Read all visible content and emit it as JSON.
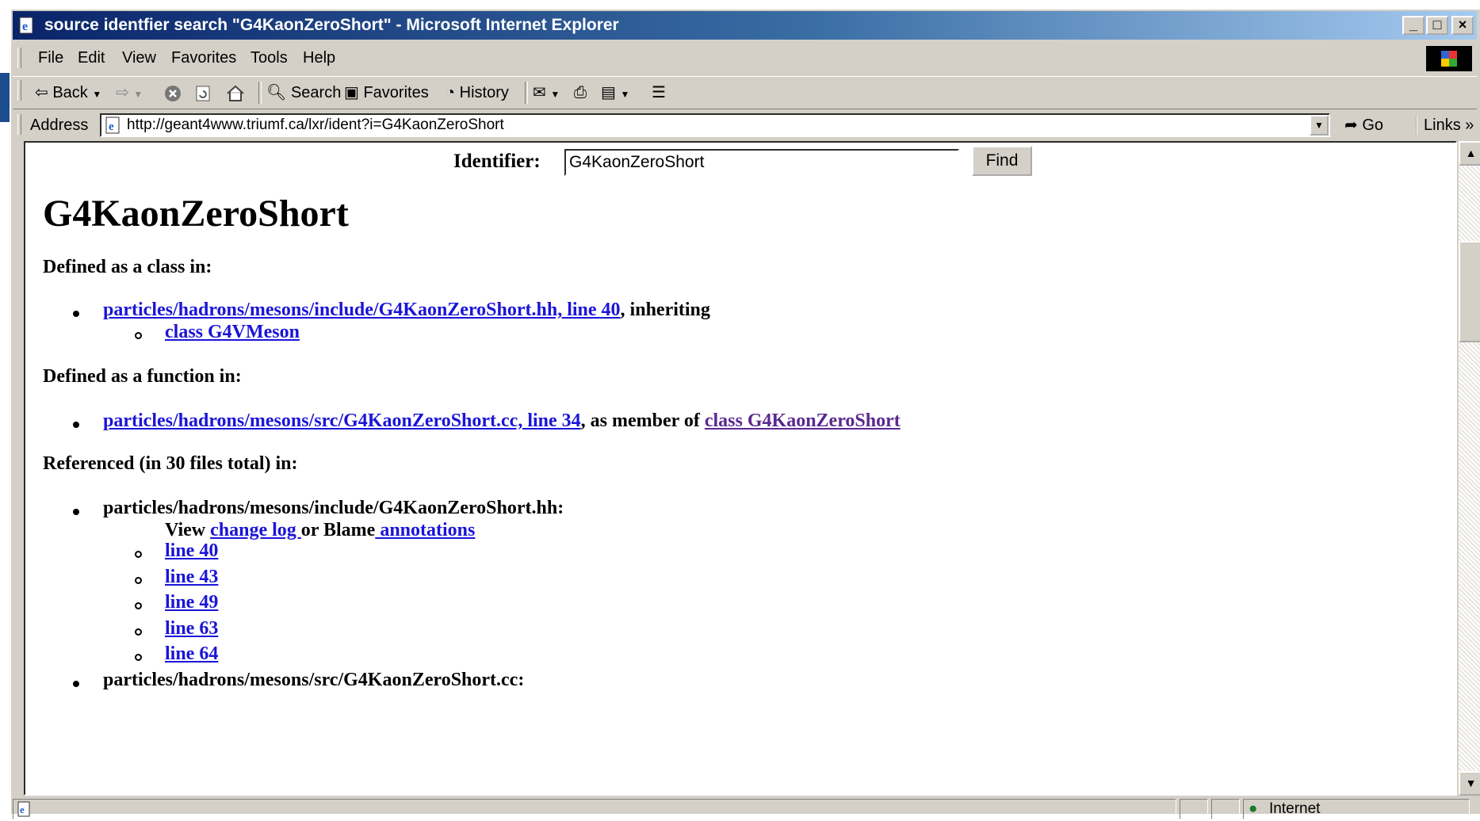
{
  "window": {
    "title": "source identfier search \"G4KaonZeroShort\" - Microsoft Internet Explorer",
    "controls": {
      "minimize": "_",
      "maximize": "□",
      "close": "×"
    }
  },
  "menu": {
    "items": [
      "File",
      "Edit",
      "View",
      "Favorites",
      "Tools",
      "Help"
    ]
  },
  "toolbar": {
    "back": "Back",
    "search": "Search",
    "favorites": "Favorites",
    "history": "History"
  },
  "address": {
    "label": "Address",
    "url": "http://geant4www.triumf.ca/lxr/ident?i=G4KaonZeroShort",
    "go": "Go",
    "links": "Links"
  },
  "page": {
    "identifier_label": "Identifier:",
    "identifier_value": "G4KaonZeroShort",
    "find_button": "Find",
    "title": "G4KaonZeroShort",
    "class_heading": "Defined as a class in:",
    "class_item": {
      "link": "particles/hadrons/mesons/include/G4KaonZeroShort.hh, line 40",
      "suffix": ", inheriting",
      "sub_link": "class G4VMeson"
    },
    "function_heading": "Defined as a function in:",
    "function_item": {
      "link": "particles/hadrons/mesons/src/G4KaonZeroShort.cc, line 34",
      "middle": ", as member of",
      "member_link": "class G4KaonZeroShort"
    },
    "referenced_heading": "Referenced (in 30 files total) in:",
    "ref_file_1": "particles/hadrons/mesons/include/G4KaonZeroShort.hh:",
    "view_prefix": "View",
    "change_log": "change log ",
    "or_blame": "or Blame",
    "annotations": " annotations",
    "lines": [
      "line 40",
      "line 43",
      "line 49",
      "line 63",
      "line 64"
    ],
    "ref_file_2": "particles/hadrons/mesons/src/G4KaonZeroShort.cc:"
  },
  "status": {
    "zone": "Internet"
  },
  "colors": {
    "link": "#1a14d8",
    "visited_link": "#5a2890",
    "titlebar_start": "#0a246a",
    "chrome": "#d4d0c8"
  },
  "icons": [
    "ie-page-icon",
    "back-arrow-icon",
    "forward-arrow-icon",
    "stop-icon",
    "refresh-icon",
    "home-icon",
    "search-icon",
    "favorites-icon",
    "history-icon",
    "mail-icon",
    "print-icon",
    "edit-icon",
    "discuss-icon",
    "go-arrow-icon",
    "globe-icon",
    "windows-logo-icon"
  ]
}
